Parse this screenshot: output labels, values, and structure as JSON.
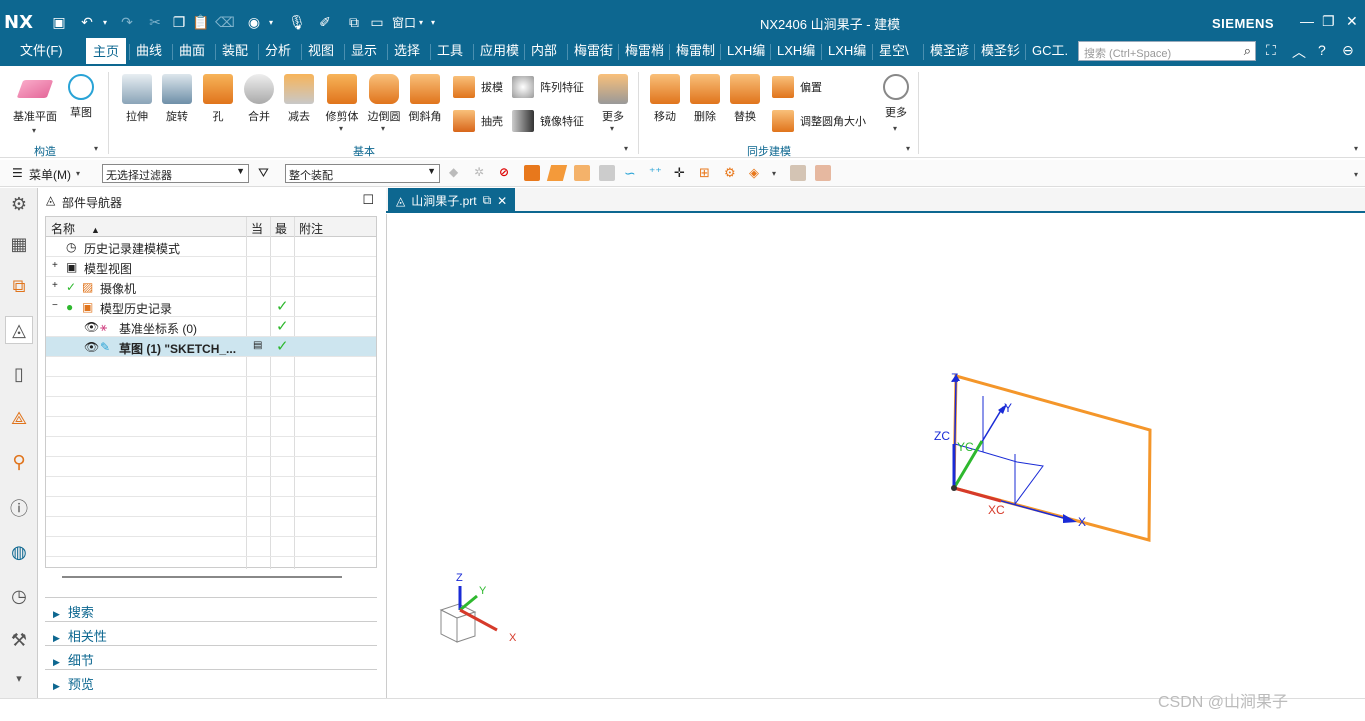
{
  "app": {
    "logo": "NX",
    "title": "NX2406 山涧果子 - 建模",
    "brand": "SIEMENS",
    "window_menu": "窗口"
  },
  "menu": {
    "file": "文件(F)",
    "tabs": [
      "主页",
      "曲线",
      "曲面",
      "装配",
      "分析",
      "视图",
      "显示",
      "选择",
      "工具",
      "应用模",
      "内部",
      "梅雷街",
      "梅雷梢",
      "梅雷制",
      "LXH编",
      "LXH编",
      "LXH编",
      "星空\\",
      "模圣谚",
      "模圣钐",
      "GC工."
    ],
    "search_placeholder": "搜索 (Ctrl+Space)"
  },
  "ribbon": {
    "construct": {
      "datum_plane": "基准平面",
      "sketch": "草图",
      "group": "构造"
    },
    "basic": {
      "extrude": "拉伸",
      "revolve": "旋转",
      "hole": "孔",
      "unite": "合并",
      "subtract": "减去",
      "trim_body": "修剪体",
      "edge_blend": "边倒圆",
      "chamfer": "倒斜角",
      "draft": "拔模",
      "shell": "抽壳",
      "pattern_feature": "阵列特征",
      "mirror_feature": "镜像特征",
      "more": "更多",
      "group": "基本"
    },
    "sync": {
      "move": "移动",
      "delete": "删除",
      "replace": "替换",
      "offset": "偏置",
      "resize_blend": "调整圆角大小",
      "more": "更多",
      "group": "同步建模"
    }
  },
  "toolbar": {
    "menu_label": "菜单(M)",
    "filter": "无选择过滤器",
    "scope": "整个装配"
  },
  "navigator": {
    "title": "部件导航器",
    "col_name": "名称",
    "col_current": "当",
    "col_latest": "最",
    "col_note": "附注",
    "rows": [
      {
        "label": "历史记录建模模式"
      },
      {
        "label": "模型视图"
      },
      {
        "label": "摄像机"
      },
      {
        "label": "模型历史记录"
      },
      {
        "label": "基准坐标系 (0)"
      },
      {
        "label": "草图 (1) \"SKETCH_..."
      }
    ],
    "sections": [
      "搜索",
      "相关性",
      "细节",
      "预览"
    ]
  },
  "doc_tab": {
    "name": "山涧果子.prt"
  },
  "viewport": {
    "axes": {
      "z": "Z",
      "y": "Y",
      "x": "X",
      "zc": "ZC",
      "yc": "YC",
      "xc": "XC"
    },
    "triad": {
      "z": "Z",
      "y": "Y",
      "x": "X"
    }
  },
  "colors": {
    "accent": "#0d6790",
    "sketch_orange": "#f4962a",
    "csys_blue": "#1a2bd6"
  },
  "watermark": "CSDN @山涧果子"
}
